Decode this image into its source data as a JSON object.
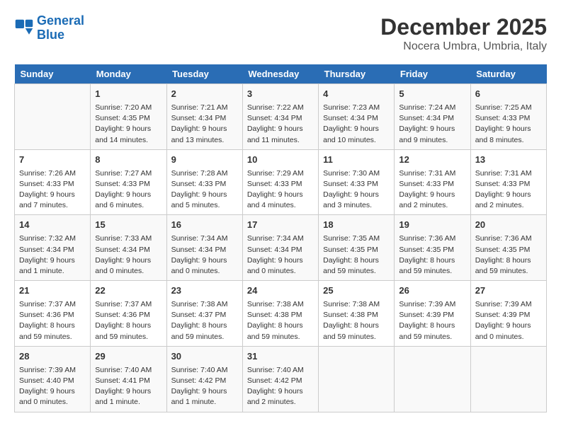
{
  "header": {
    "logo_line1": "General",
    "logo_line2": "Blue",
    "month": "December 2025",
    "location": "Nocera Umbra, Umbria, Italy"
  },
  "days_of_week": [
    "Sunday",
    "Monday",
    "Tuesday",
    "Wednesday",
    "Thursday",
    "Friday",
    "Saturday"
  ],
  "weeks": [
    [
      {
        "day": "",
        "info": ""
      },
      {
        "day": "1",
        "info": "Sunrise: 7:20 AM\nSunset: 4:35 PM\nDaylight: 9 hours\nand 14 minutes."
      },
      {
        "day": "2",
        "info": "Sunrise: 7:21 AM\nSunset: 4:34 PM\nDaylight: 9 hours\nand 13 minutes."
      },
      {
        "day": "3",
        "info": "Sunrise: 7:22 AM\nSunset: 4:34 PM\nDaylight: 9 hours\nand 11 minutes."
      },
      {
        "day": "4",
        "info": "Sunrise: 7:23 AM\nSunset: 4:34 PM\nDaylight: 9 hours\nand 10 minutes."
      },
      {
        "day": "5",
        "info": "Sunrise: 7:24 AM\nSunset: 4:34 PM\nDaylight: 9 hours\nand 9 minutes."
      },
      {
        "day": "6",
        "info": "Sunrise: 7:25 AM\nSunset: 4:33 PM\nDaylight: 9 hours\nand 8 minutes."
      }
    ],
    [
      {
        "day": "7",
        "info": "Sunrise: 7:26 AM\nSunset: 4:33 PM\nDaylight: 9 hours\nand 7 minutes."
      },
      {
        "day": "8",
        "info": "Sunrise: 7:27 AM\nSunset: 4:33 PM\nDaylight: 9 hours\nand 6 minutes."
      },
      {
        "day": "9",
        "info": "Sunrise: 7:28 AM\nSunset: 4:33 PM\nDaylight: 9 hours\nand 5 minutes."
      },
      {
        "day": "10",
        "info": "Sunrise: 7:29 AM\nSunset: 4:33 PM\nDaylight: 9 hours\nand 4 minutes."
      },
      {
        "day": "11",
        "info": "Sunrise: 7:30 AM\nSunset: 4:33 PM\nDaylight: 9 hours\nand 3 minutes."
      },
      {
        "day": "12",
        "info": "Sunrise: 7:31 AM\nSunset: 4:33 PM\nDaylight: 9 hours\nand 2 minutes."
      },
      {
        "day": "13",
        "info": "Sunrise: 7:31 AM\nSunset: 4:33 PM\nDaylight: 9 hours\nand 2 minutes."
      }
    ],
    [
      {
        "day": "14",
        "info": "Sunrise: 7:32 AM\nSunset: 4:34 PM\nDaylight: 9 hours\nand 1 minute."
      },
      {
        "day": "15",
        "info": "Sunrise: 7:33 AM\nSunset: 4:34 PM\nDaylight: 9 hours\nand 0 minutes."
      },
      {
        "day": "16",
        "info": "Sunrise: 7:34 AM\nSunset: 4:34 PM\nDaylight: 9 hours\nand 0 minutes."
      },
      {
        "day": "17",
        "info": "Sunrise: 7:34 AM\nSunset: 4:34 PM\nDaylight: 9 hours\nand 0 minutes."
      },
      {
        "day": "18",
        "info": "Sunrise: 7:35 AM\nSunset: 4:35 PM\nDaylight: 8 hours\nand 59 minutes."
      },
      {
        "day": "19",
        "info": "Sunrise: 7:36 AM\nSunset: 4:35 PM\nDaylight: 8 hours\nand 59 minutes."
      },
      {
        "day": "20",
        "info": "Sunrise: 7:36 AM\nSunset: 4:35 PM\nDaylight: 8 hours\nand 59 minutes."
      }
    ],
    [
      {
        "day": "21",
        "info": "Sunrise: 7:37 AM\nSunset: 4:36 PM\nDaylight: 8 hours\nand 59 minutes."
      },
      {
        "day": "22",
        "info": "Sunrise: 7:37 AM\nSunset: 4:36 PM\nDaylight: 8 hours\nand 59 minutes."
      },
      {
        "day": "23",
        "info": "Sunrise: 7:38 AM\nSunset: 4:37 PM\nDaylight: 8 hours\nand 59 minutes."
      },
      {
        "day": "24",
        "info": "Sunrise: 7:38 AM\nSunset: 4:38 PM\nDaylight: 8 hours\nand 59 minutes."
      },
      {
        "day": "25",
        "info": "Sunrise: 7:38 AM\nSunset: 4:38 PM\nDaylight: 8 hours\nand 59 minutes."
      },
      {
        "day": "26",
        "info": "Sunrise: 7:39 AM\nSunset: 4:39 PM\nDaylight: 8 hours\nand 59 minutes."
      },
      {
        "day": "27",
        "info": "Sunrise: 7:39 AM\nSunset: 4:39 PM\nDaylight: 9 hours\nand 0 minutes."
      }
    ],
    [
      {
        "day": "28",
        "info": "Sunrise: 7:39 AM\nSunset: 4:40 PM\nDaylight: 9 hours\nand 0 minutes."
      },
      {
        "day": "29",
        "info": "Sunrise: 7:40 AM\nSunset: 4:41 PM\nDaylight: 9 hours\nand 1 minute."
      },
      {
        "day": "30",
        "info": "Sunrise: 7:40 AM\nSunset: 4:42 PM\nDaylight: 9 hours\nand 1 minute."
      },
      {
        "day": "31",
        "info": "Sunrise: 7:40 AM\nSunset: 4:42 PM\nDaylight: 9 hours\nand 2 minutes."
      },
      {
        "day": "",
        "info": ""
      },
      {
        "day": "",
        "info": ""
      },
      {
        "day": "",
        "info": ""
      }
    ]
  ]
}
